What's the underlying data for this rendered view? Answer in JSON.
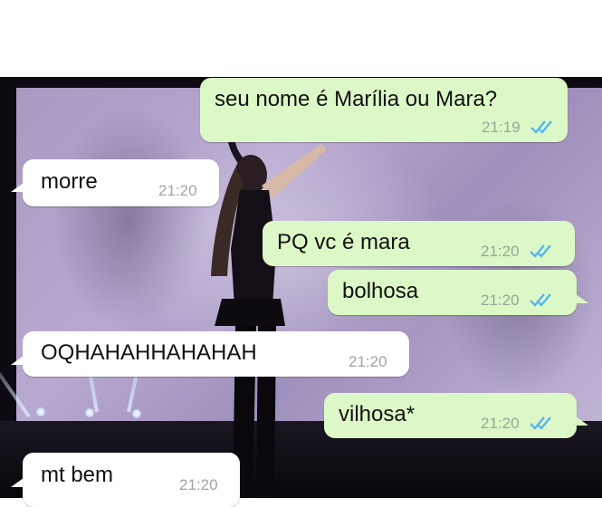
{
  "conversation": {
    "messages": [
      {
        "direction": "outgoing",
        "text": "seu nome é Marília ou Mara?",
        "time": "21:19",
        "status": "read"
      },
      {
        "direction": "incoming",
        "text": "morre",
        "time": "21:20"
      },
      {
        "direction": "outgoing",
        "text": "PQ vc é mara",
        "time": "21:20",
        "status": "read"
      },
      {
        "direction": "outgoing",
        "text": "bolhosa",
        "time": "21:20",
        "status": "read"
      },
      {
        "direction": "incoming",
        "text": "OQHAHAHHAHAHAH",
        "time": "21:20"
      },
      {
        "direction": "outgoing",
        "text": "vilhosa*",
        "time": "21:20",
        "status": "read"
      },
      {
        "direction": "incoming",
        "text": "mt bem",
        "time": "21:20"
      }
    ]
  },
  "colors": {
    "outgoing_bubble": "#dcf8c6",
    "incoming_bubble": "#ffffff",
    "read_ticks": "#4fb3f6"
  },
  "icons": {
    "read_status": "double-check-icon"
  }
}
